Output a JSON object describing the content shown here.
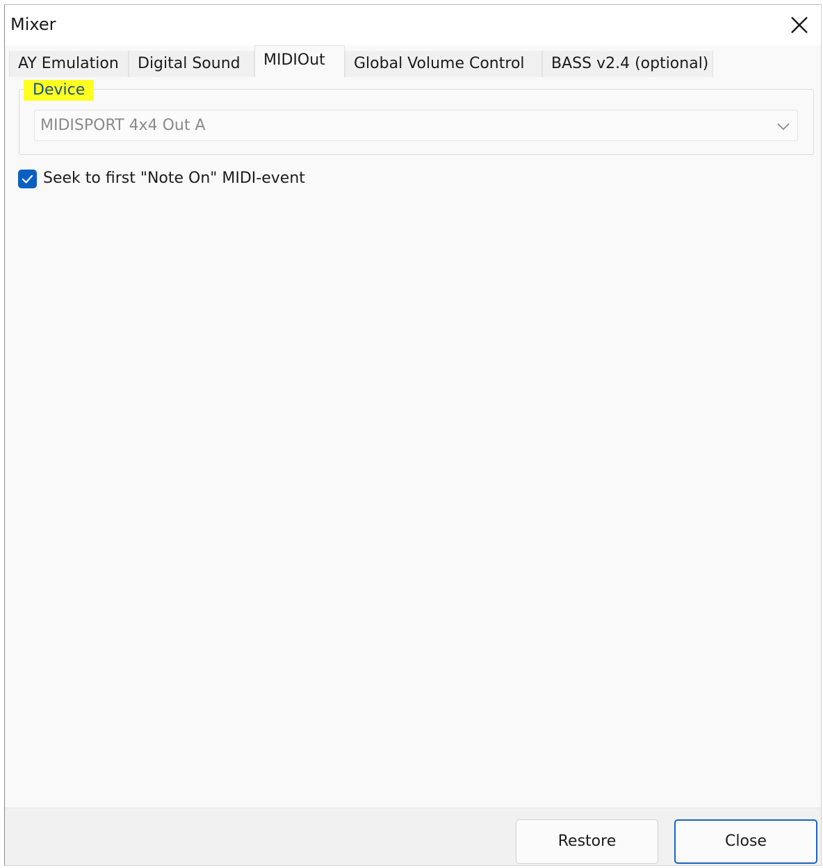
{
  "window": {
    "title": "Mixer"
  },
  "tabs": [
    {
      "label": "AY Emulation",
      "active": false
    },
    {
      "label": "Digital Sound",
      "active": false
    },
    {
      "label": "MIDIOut",
      "active": true
    },
    {
      "label": "Global Volume Control",
      "active": false
    },
    {
      "label": "BASS v2.4 (optional)",
      "active": false
    }
  ],
  "device_group": {
    "legend": "Device",
    "selected_device": "MIDISPORT 4x4 Out A"
  },
  "options": {
    "seek_first_note_on": {
      "label": "Seek to first \"Note On\" MIDI-event",
      "checked": true
    }
  },
  "footer": {
    "restore_label": "Restore",
    "close_label": "Close"
  },
  "icons": {
    "window_close": "close-icon",
    "combo_dropdown": "chevron-down-icon",
    "checkbox_mark": "checkmark-icon"
  },
  "colors": {
    "accent": "#0a5fc2",
    "highlight": "#ffff22",
    "legend_text": "#1a4f8a"
  }
}
